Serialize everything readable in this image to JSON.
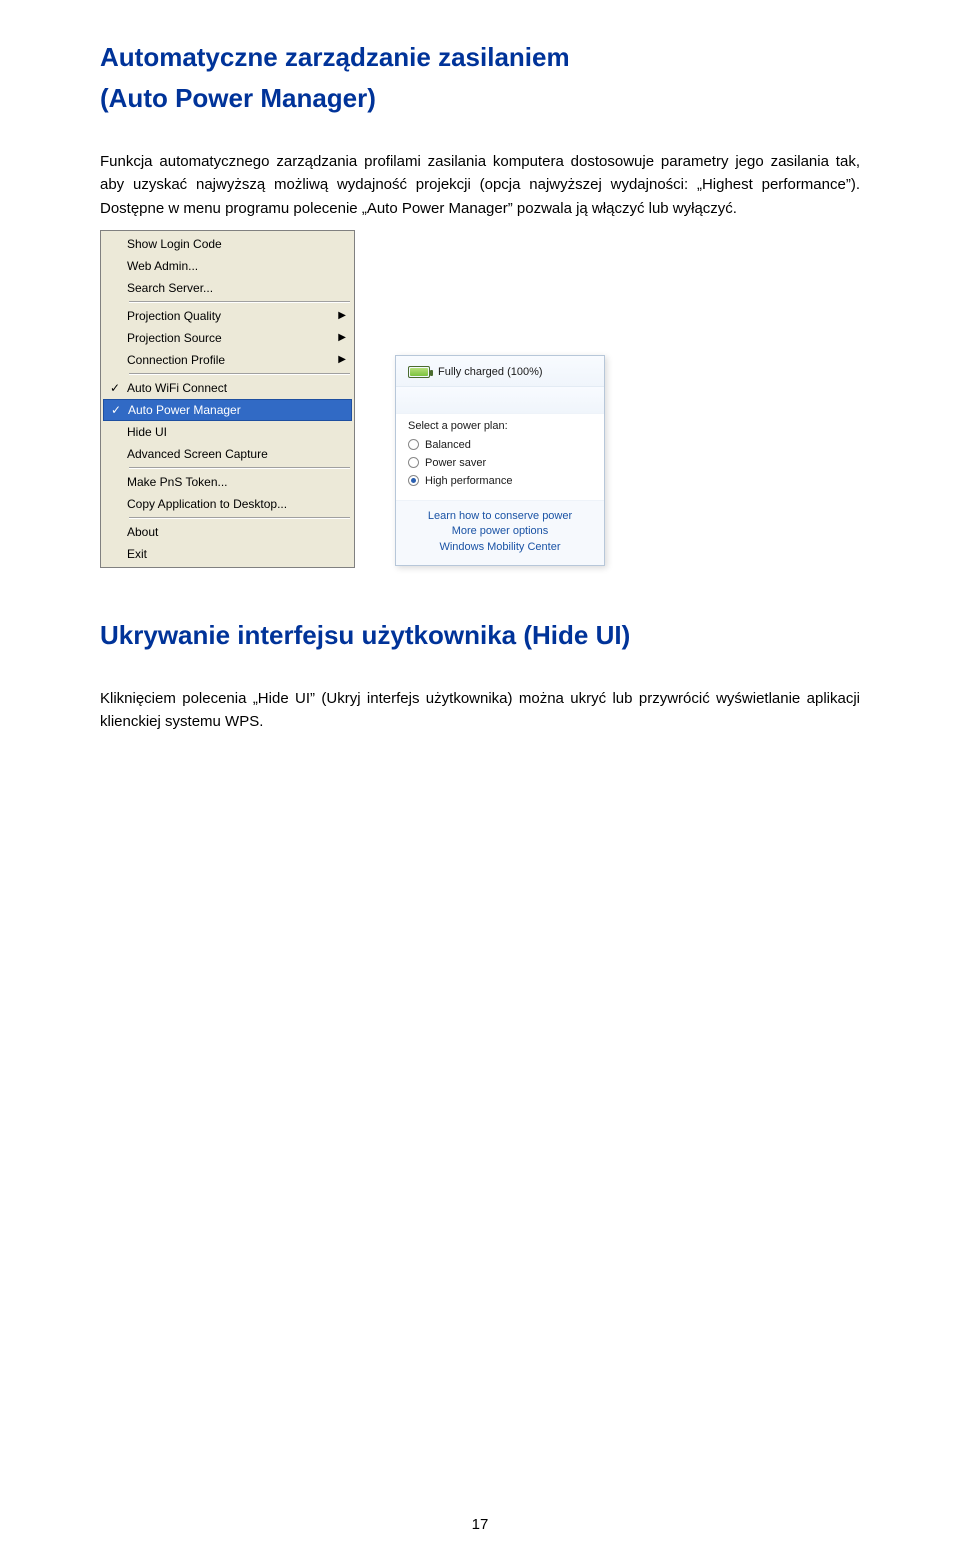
{
  "headings": {
    "h1_line1": "Automatyczne zarządzanie zasilaniem",
    "h1_line2": "(Auto Power Manager)",
    "h2": "Ukrywanie interfejsu użytkownika (Hide UI)"
  },
  "paragraphs": {
    "p1": "Funkcja automatycznego zarządzania profilami zasilania komputera dostosowuje parametry jego zasilania tak, aby uzyskać najwyższą możliwą wydajność projekcji (opcja najwyższej wydajności: „Highest performance”).   Dostępne w menu programu polecenie „Auto Power Manager” pozwala ją włączyć lub wyłączyć.",
    "p2": "Kliknięciem polecenia „Hide UI” (Ukryj interfejs użytkownika) można ukryć lub przywrócić wyświetlanie aplikacji klienckiej systemu WPS."
  },
  "context_menu": {
    "items": [
      {
        "label": "Show Login Code",
        "checked": false,
        "submenu": false
      },
      {
        "label": "Web Admin...",
        "checked": false,
        "submenu": false
      },
      {
        "label": "Search Server...",
        "checked": false,
        "submenu": false
      }
    ],
    "group2": [
      {
        "label": "Projection Quality",
        "checked": false,
        "submenu": true
      },
      {
        "label": "Projection Source",
        "checked": false,
        "submenu": true
      },
      {
        "label": "Connection Profile",
        "checked": false,
        "submenu": true
      }
    ],
    "group3": [
      {
        "label": "Auto WiFi Connect",
        "checked": true,
        "submenu": false,
        "highlight": false
      },
      {
        "label": "Auto Power Manager",
        "checked": true,
        "submenu": false,
        "highlight": true
      },
      {
        "label": "Hide UI",
        "checked": false,
        "submenu": false,
        "highlight": false
      },
      {
        "label": "Advanced Screen Capture",
        "checked": false,
        "submenu": false,
        "highlight": false
      }
    ],
    "group4": [
      {
        "label": "Make PnS Token...",
        "checked": false,
        "submenu": false
      },
      {
        "label": "Copy Application to Desktop...",
        "checked": false,
        "submenu": false
      }
    ],
    "group5": [
      {
        "label": "About",
        "checked": false,
        "submenu": false
      },
      {
        "label": "Exit",
        "checked": false,
        "submenu": false
      }
    ]
  },
  "power_panel": {
    "status": "Fully charged (100%)",
    "plan_label": "Select a power plan:",
    "plans": [
      {
        "label": "Balanced",
        "selected": false
      },
      {
        "label": "Power saver",
        "selected": false
      },
      {
        "label": "High performance",
        "selected": true
      }
    ],
    "links": [
      "Learn how to conserve power",
      "More power options",
      "Windows Mobility Center"
    ]
  },
  "page_number": "17"
}
